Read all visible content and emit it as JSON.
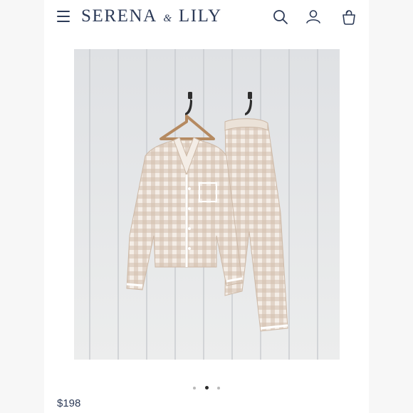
{
  "header": {
    "brand_name": "SERENA",
    "brand_amp": "&",
    "brand_name_2": "LILY",
    "icons": [
      "menu-icon",
      "search-icon",
      "account-icon",
      "bag-icon"
    ],
    "brand_color": "#2c3a57"
  },
  "product": {
    "image_icon": "product-photo",
    "carousel": {
      "count": 3,
      "active_index": 1
    },
    "price": "$198"
  }
}
